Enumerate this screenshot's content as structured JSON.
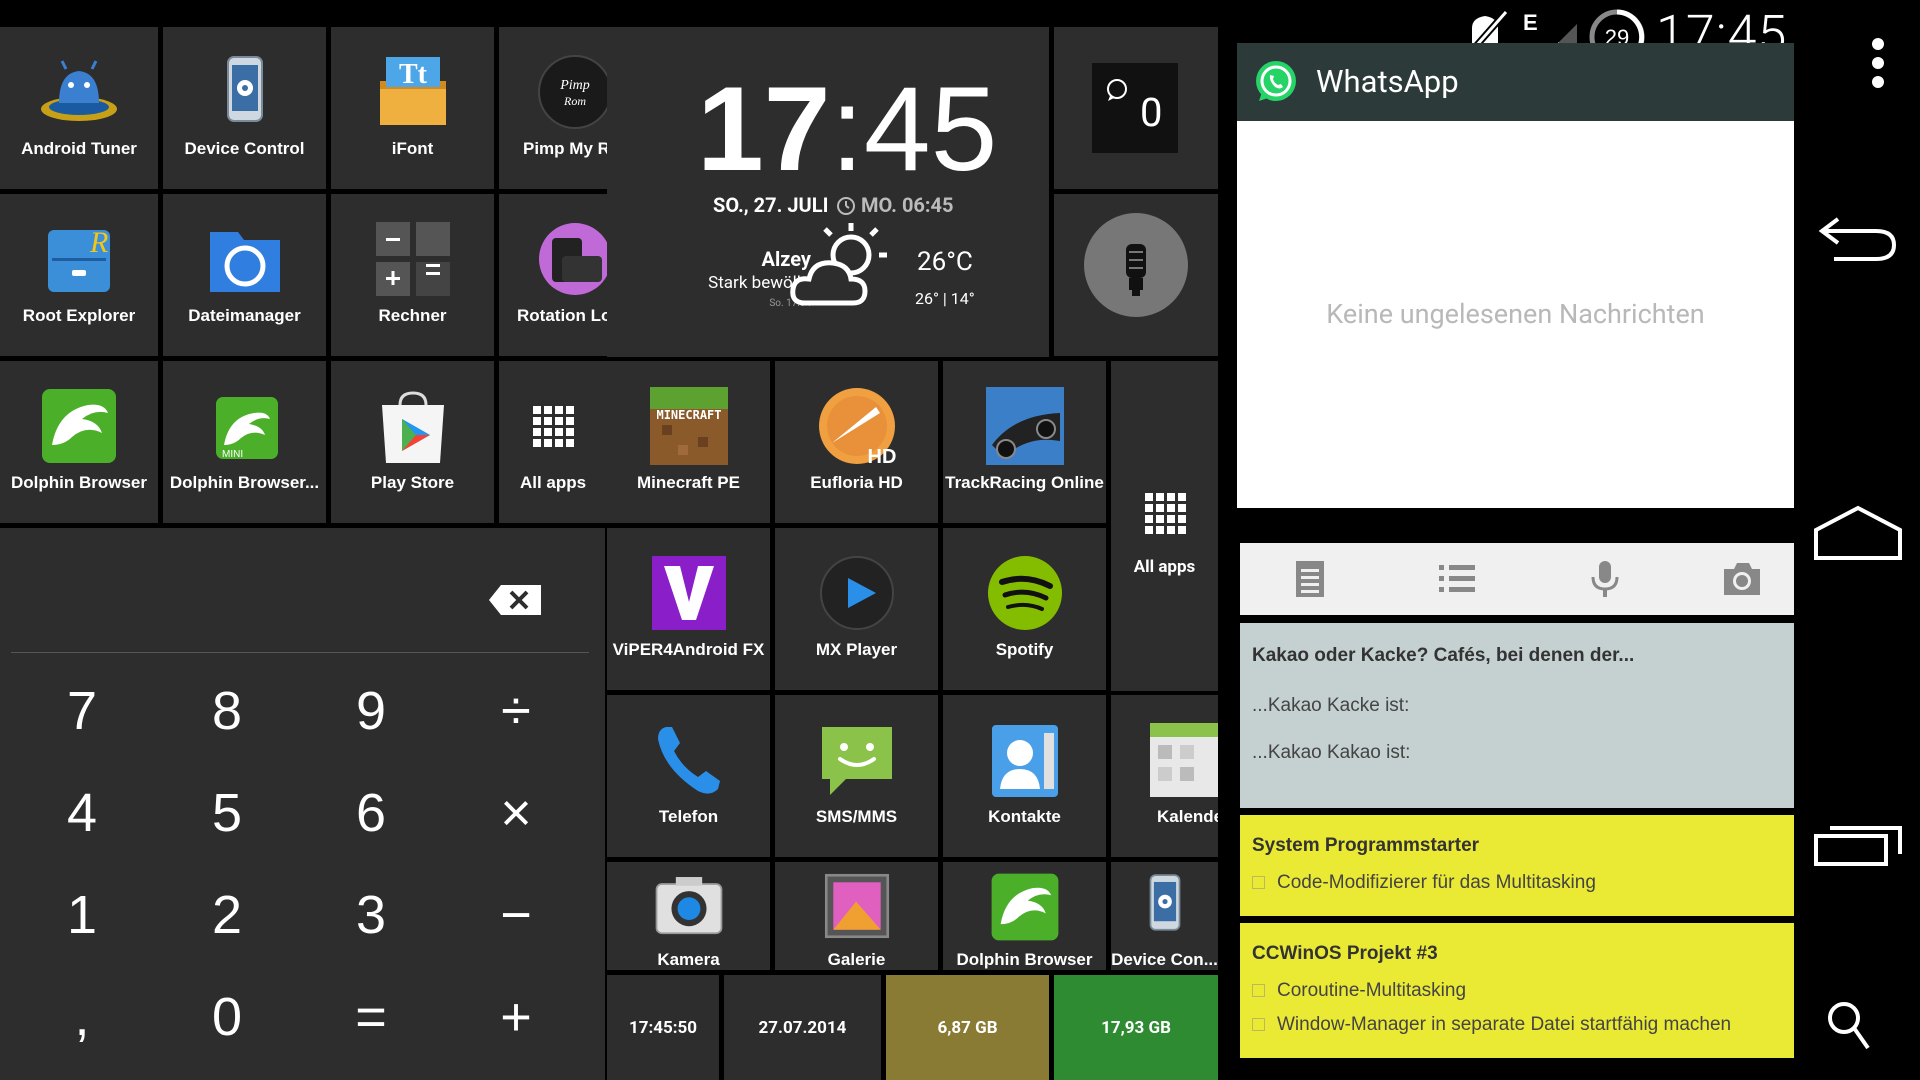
{
  "status_bar": {
    "network_type": "E",
    "battery_level": "29",
    "time": "17:45"
  },
  "apps": {
    "android_tuner": "Android Tuner",
    "device_control": "Device Control",
    "ifont": "iFont",
    "pimp_my_rom": "Pimp My R",
    "root_explorer": "Root Explorer",
    "dateimanager": "Dateimanager",
    "rechner": "Rechner",
    "rotation_lock": "Rotation Lo",
    "dolphin_browser": "Dolphin Browser",
    "dolphin_browser_mini": "Dolphin Browser...",
    "play_store": "Play Store",
    "all_apps_1": "All apps",
    "minecraft_pe": "Minecraft PE",
    "eufloria_hd": "Eufloria HD",
    "trackracing": "TrackRacing Online",
    "all_apps_2": "All apps",
    "viper4android": "ViPER4Android FX",
    "mx_player": "MX Player",
    "spotify": "Spotify",
    "telefon": "Telefon",
    "sms_mms": "SMS/MMS",
    "kontakte": "Kontakte",
    "kalender": "Kalende",
    "kamera": "Kamera",
    "galerie": "Galerie",
    "dolphin_browser_2": "Dolphin Browser",
    "device_control_2": "Device Con..."
  },
  "clock_widget": {
    "hours": "17",
    "minutes": "45",
    "date": "SO., 27. JULI",
    "alarm": "MO. 06:45",
    "city": "Alzey",
    "condition": "Stark bewölkt",
    "updated": "So. 17:34",
    "temperature": "26°C",
    "temp_range": "26° | 14°"
  },
  "whatsapp_counter": {
    "count": "0"
  },
  "whatsapp_widget": {
    "title": "WhatsApp",
    "empty_message": "Keine ungelesenen Nachrichten"
  },
  "notes": [
    {
      "title": "Kakao oder Kacke? Cafés, bei denen der...",
      "lines": [
        "...Kakao Kacke ist:",
        "...Kakao Kakao ist:"
      ],
      "color": "#c5d0d0"
    },
    {
      "title": "System Programmstarter",
      "items": [
        "Code-Modifizierer für das Multitasking"
      ],
      "color": "#eaea35"
    },
    {
      "title": "CCWinOS Projekt #3",
      "items": [
        "Coroutine-Multitasking",
        "Window-Manager in separate Datei startfähig machen"
      ],
      "color": "#eaea35"
    }
  ],
  "calculator": {
    "keys": [
      [
        "7",
        "8",
        "9",
        "÷"
      ],
      [
        "4",
        "5",
        "6",
        "×"
      ],
      [
        "1",
        "2",
        "3",
        "−"
      ],
      [
        ",",
        "0",
        "=",
        "+"
      ]
    ]
  },
  "bottom_bar": {
    "time": "17:45:50",
    "date": "27.07.2014",
    "storage_1": "6,87 GB",
    "storage_2": "17,93 GB",
    "storage_1_color": "#8a7b34",
    "storage_2_color": "#2e8b31"
  },
  "colors": {
    "tile": "#2d2d2d",
    "whatsapp_header": "#2c3b3a",
    "whatsapp_green": "#25d366",
    "note_gray": "#c5d0d0",
    "note_yellow": "#eaea35"
  }
}
